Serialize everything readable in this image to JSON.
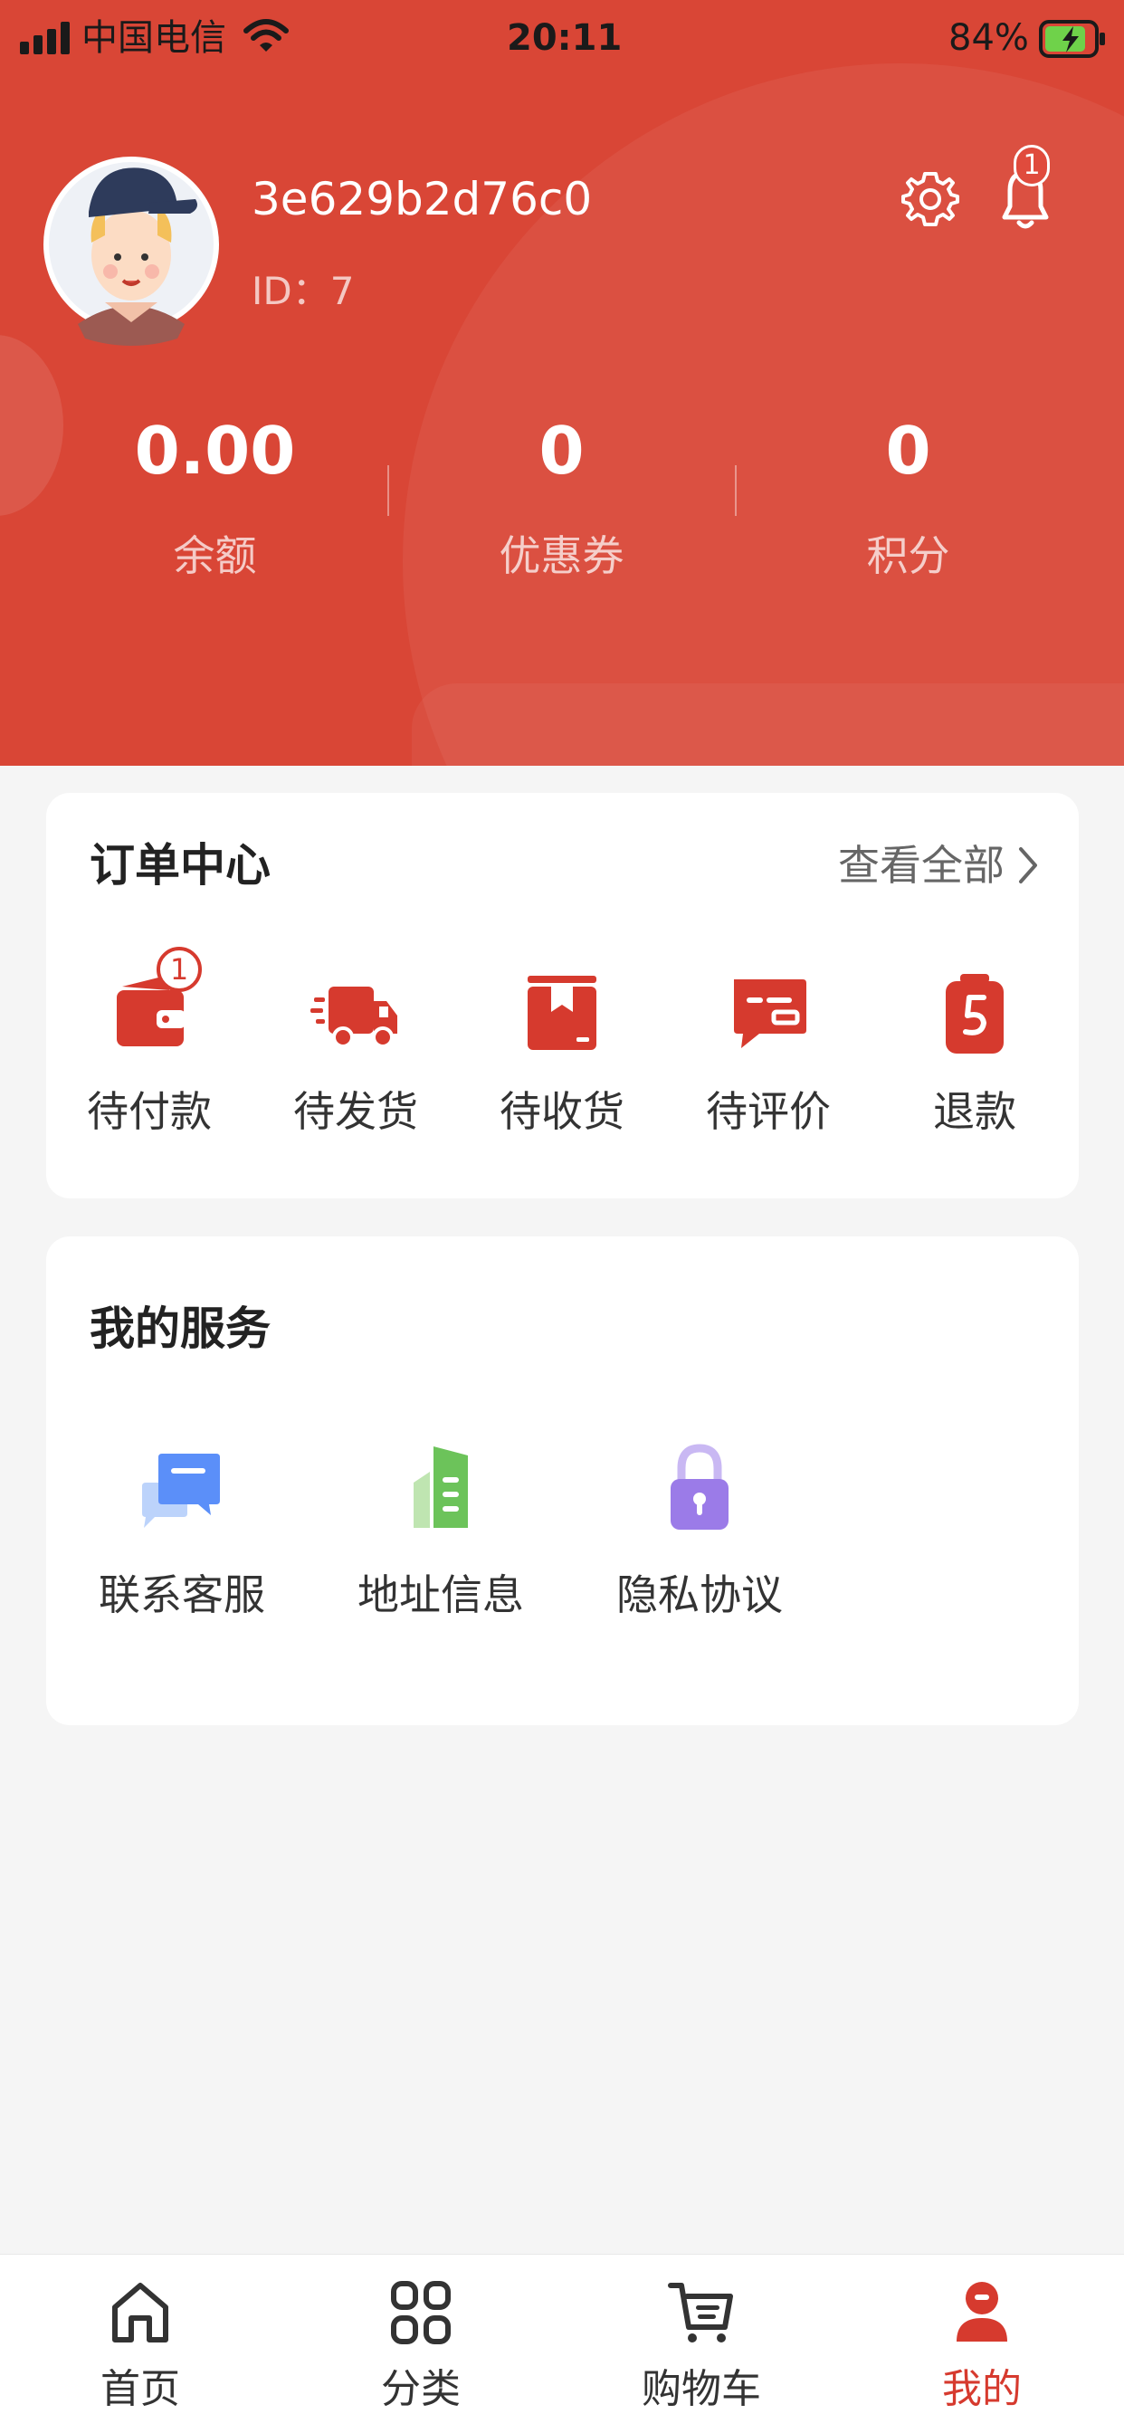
{
  "status_bar": {
    "carrier": "中国电信",
    "time": "20:11",
    "battery_percent": "84%",
    "battery_level": 0.84
  },
  "profile": {
    "username": "3e629b2d76c0",
    "id_label": "ID：7",
    "notification_count": "1"
  },
  "stats": [
    {
      "value": "0.00",
      "label": "余额"
    },
    {
      "value": "0",
      "label": "优惠券"
    },
    {
      "value": "0",
      "label": "积分"
    }
  ],
  "orders": {
    "title": "订单中心",
    "view_all": "查看全部",
    "items": [
      {
        "label": "待付款",
        "icon": "wallet-icon",
        "badge": "1"
      },
      {
        "label": "待发货",
        "icon": "truck-icon"
      },
      {
        "label": "待收货",
        "icon": "package-icon"
      },
      {
        "label": "待评价",
        "icon": "review-icon"
      },
      {
        "label": "退款",
        "icon": "refund-icon"
      }
    ]
  },
  "services": {
    "title": "我的服务",
    "items": [
      {
        "label": "联系客服",
        "icon": "customer-service-icon"
      },
      {
        "label": "地址信息",
        "icon": "address-icon"
      },
      {
        "label": "隐私协议",
        "icon": "lock-icon"
      }
    ]
  },
  "tabbar": {
    "items": [
      {
        "label": "首页",
        "icon": "home-icon"
      },
      {
        "label": "分类",
        "icon": "category-icon"
      },
      {
        "label": "购物车",
        "icon": "cart-icon"
      },
      {
        "label": "我的",
        "icon": "profile-icon",
        "active": true
      }
    ]
  },
  "colors": {
    "header_bg": "#d94636",
    "accent": "#d63a2e",
    "service_blue": "#5b8ff9",
    "service_green": "#6cc35a",
    "service_purple": "#9b7be8"
  }
}
